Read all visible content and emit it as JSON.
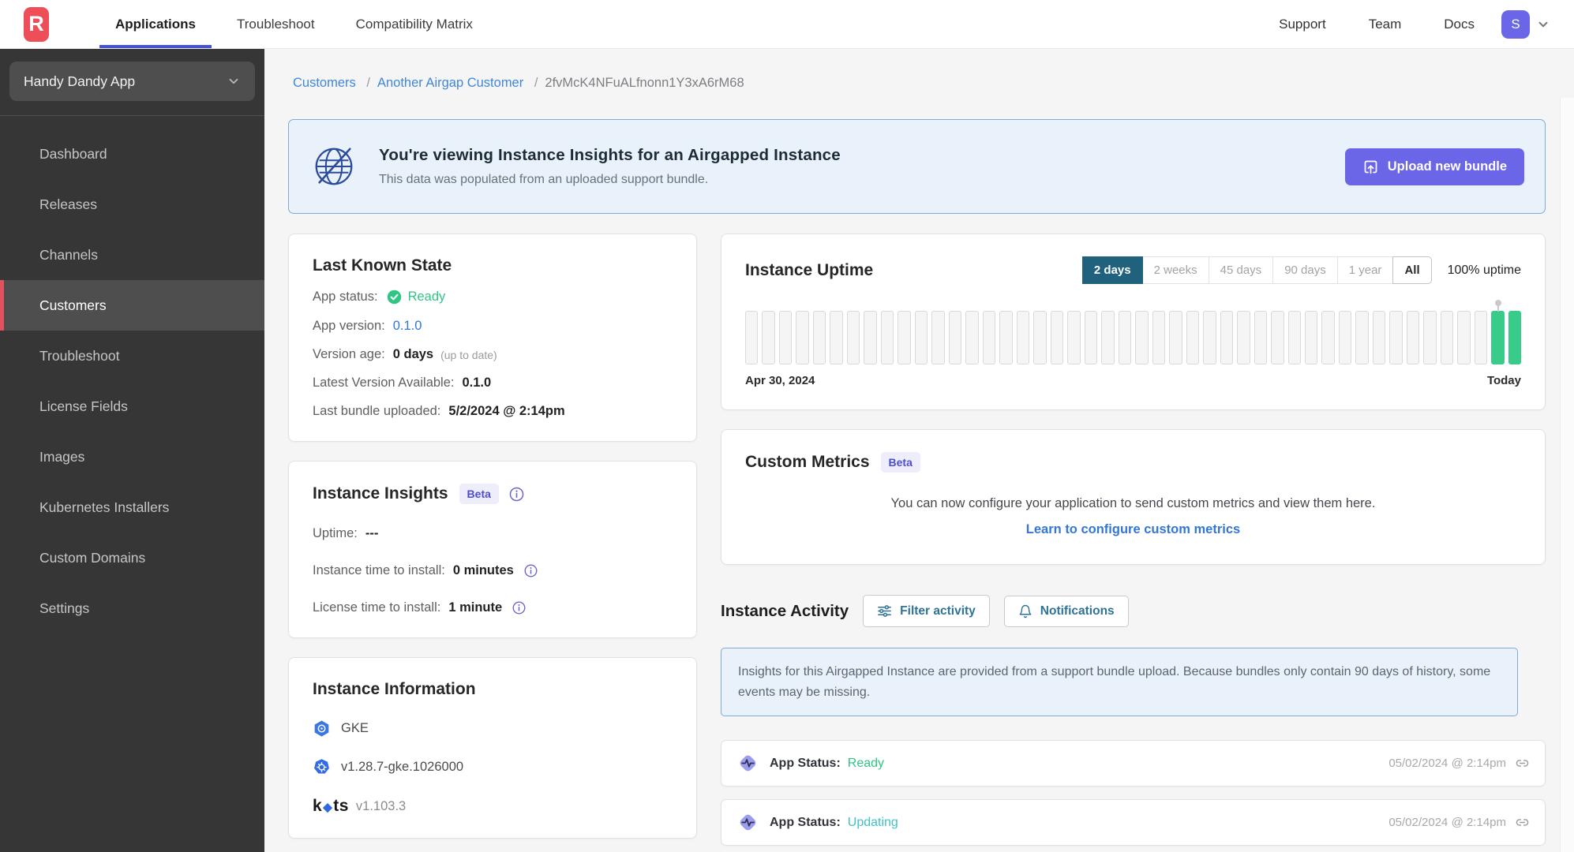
{
  "colors": {
    "brand_red": "#ed4e58",
    "accent_indigo": "#6b65e8",
    "nav_active_blue": "#4353e0",
    "link_blue": "#4087d8",
    "value_blue": "#3376d6",
    "status_green": "#2fc584",
    "status_teal": "#3fc1c5",
    "uptime_green": "#38cb89",
    "range_active": "#20617e",
    "sidebar_active_red": "#e4505c"
  },
  "topbar": {
    "logo_letter": "R",
    "nav": [
      {
        "label": "Applications",
        "active": true
      },
      {
        "label": "Troubleshoot",
        "active": false
      },
      {
        "label": "Compatibility Matrix",
        "active": false
      }
    ],
    "links": [
      {
        "label": "Support"
      },
      {
        "label": "Team"
      },
      {
        "label": "Docs"
      }
    ],
    "avatar_letter": "S"
  },
  "sidebar": {
    "app_selector": "Handy Dandy App",
    "items": [
      {
        "label": "Dashboard",
        "active": false
      },
      {
        "label": "Releases",
        "active": false
      },
      {
        "label": "Channels",
        "active": false
      },
      {
        "label": "Customers",
        "active": true
      },
      {
        "label": "Troubleshoot",
        "active": false
      },
      {
        "label": "License Fields",
        "active": false
      },
      {
        "label": "Images",
        "active": false
      },
      {
        "label": "Kubernetes Installers",
        "active": false
      },
      {
        "label": "Custom Domains",
        "active": false
      },
      {
        "label": "Settings",
        "active": false
      }
    ]
  },
  "breadcrumb": {
    "items": [
      {
        "label": "Customers",
        "link": true
      },
      {
        "label": "Another Airgap Customer",
        "link": true
      },
      {
        "label": "2fvMcK4NFuALfnonn1Y3xA6rM68",
        "link": false
      }
    ]
  },
  "banner": {
    "title": "You're viewing Instance Insights for an Airgapped Instance",
    "subtitle": "This data was populated from an uploaded support bundle.",
    "button_label": "Upload new bundle"
  },
  "last_known_state": {
    "title": "Last Known State",
    "app_status_label": "App status:",
    "app_status_value": "Ready",
    "app_version_label": "App version:",
    "app_version_value": "0.1.0",
    "version_age_label": "Version age:",
    "version_age_value": "0 days",
    "version_age_note": "(up to date)",
    "latest_version_label": "Latest Version Available:",
    "latest_version_value": "0.1.0",
    "last_bundle_label": "Last bundle uploaded:",
    "last_bundle_value": "5/2/2024 @ 2:14pm"
  },
  "instance_uptime": {
    "title": "Instance Uptime",
    "ranges": [
      {
        "label": "2 days",
        "active": true
      },
      {
        "label": "2 weeks",
        "active": false
      },
      {
        "label": "45 days",
        "active": false
      },
      {
        "label": "90 days",
        "active": false
      },
      {
        "label": "1 year",
        "active": false
      },
      {
        "label": "All",
        "active": false,
        "emphasized": true
      }
    ],
    "uptime_summary": "100% uptime",
    "bars_total": 46,
    "bars_up": 2,
    "start_label": "Apr 30, 2024",
    "end_label": "Today"
  },
  "custom_metrics": {
    "title": "Custom Metrics",
    "badge": "Beta",
    "body": "You can now configure your application to send custom metrics and view them here.",
    "link": "Learn to configure custom metrics"
  },
  "instance_insights": {
    "title": "Instance Insights",
    "badge": "Beta",
    "uptime_label": "Uptime:",
    "uptime_value": "---",
    "instance_install_label": "Instance time to install:",
    "instance_install_value": "0 minutes",
    "license_install_label": "License time to install:",
    "license_install_value": "1 minute"
  },
  "instance_information": {
    "title": "Instance Information",
    "distribution": "GKE",
    "kubernetes_version": "v1.28.7-gke.1026000",
    "kots_prefix": "k",
    "kots_suffix": "ts",
    "kots_diamond": "◆",
    "kots_version": "v1.103.3"
  },
  "instance_activity": {
    "title": "Instance Activity",
    "filter_button": "Filter activity",
    "notifications_button": "Notifications",
    "note": "Insights for this Airgapped Instance are provided from a support bundle upload. Because bundles only contain 90 days of history, some events may be missing.",
    "events": [
      {
        "label": "App Status:",
        "value": "Ready",
        "value_color": "green",
        "timestamp": "05/02/2024 @ 2:14pm"
      },
      {
        "label": "App Status:",
        "value": "Updating",
        "value_color": "teal",
        "timestamp": "05/02/2024 @ 2:14pm"
      }
    ]
  }
}
